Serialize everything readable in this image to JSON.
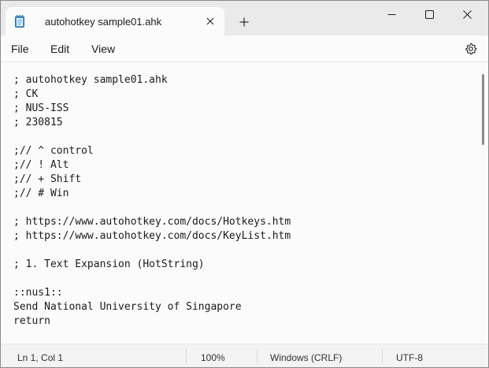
{
  "tab": {
    "title": "autohotkey sample01.ahk",
    "icon": "notepad-icon",
    "close_icon": "close-icon",
    "new_tab_icon": "plus-icon"
  },
  "window_controls": {
    "minimize_icon": "minimize-icon",
    "maximize_icon": "maximize-icon",
    "close_icon": "close-icon"
  },
  "menu": {
    "file": "File",
    "edit": "Edit",
    "view": "View",
    "settings_icon": "gear-icon"
  },
  "editor": {
    "lines": [
      "; autohotkey sample01.ahk",
      "; CK",
      "; NUS-ISS",
      "; 230815",
      "",
      ";// ^ control",
      ";// ! Alt",
      ";// + Shift",
      ";// # Win",
      "",
      "; https://www.autohotkey.com/docs/Hotkeys.htm",
      "; https://www.autohotkey.com/docs/KeyList.htm",
      "",
      "; 1. Text Expansion (HotString)",
      "",
      "::nus1::",
      "Send National University of Singapore",
      "return"
    ]
  },
  "status": {
    "position": "Ln 1, Col 1",
    "zoom": "100%",
    "line_ending": "Windows (CRLF)",
    "encoding": "UTF-8"
  },
  "colors": {
    "titlebar": "#eaeaea",
    "editor_bg": "#fbfbfb",
    "text": "#1b1b1b"
  }
}
